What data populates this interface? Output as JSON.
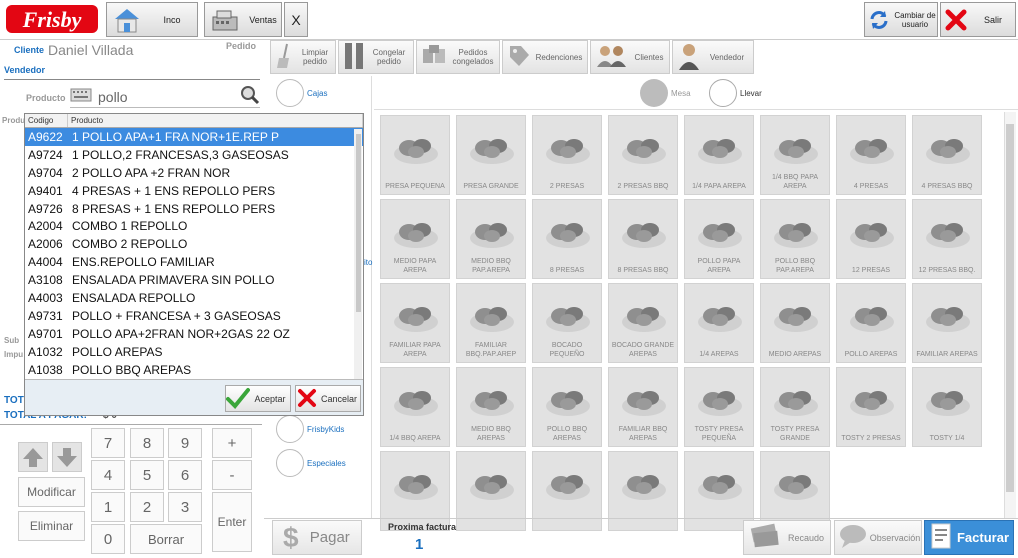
{
  "brand": {
    "logo_text": "Frisby",
    "accent": "#e30613",
    "blue": "#1a6fbf"
  },
  "toolbar": {
    "inicio_label": "Inco",
    "ventas_label": "Ventas",
    "close_label": "X",
    "cambiar_label_1": "Cambiar de",
    "cambiar_label_2": "usuario",
    "salir_label": "Salir"
  },
  "left": {
    "cliente_label": "Cliente",
    "cliente_value": "Daniel Villada",
    "pedido_label": "Pedido",
    "vendedor_label": "Vendedor",
    "producto_label": "Producto",
    "producto_value": "pollo",
    "produ_label": "Produ",
    "sub_label": "Sub",
    "impu_label": "Impu",
    "tot_label": "TOT",
    "total_pagar_label": "TOTAL A PAGAR:",
    "total_pagar_value": "$ 0"
  },
  "dropdown": {
    "col_codigo": "Codigo",
    "col_producto": "Producto",
    "rows": [
      {
        "code": "A9622",
        "name": "1 POLLO APA+1 FRA NOR+1E.REP P"
      },
      {
        "code": "A9724",
        "name": "1 POLLO,2 FRANCESAS,3 GASEOSAS"
      },
      {
        "code": "A9704",
        "name": "2 POLLO APA +2 FRAN NOR"
      },
      {
        "code": "A9401",
        "name": "4 PRESAS + 1 ENS REPOLLO PERS"
      },
      {
        "code": "A9726",
        "name": "8 PRESAS + 1 ENS REPOLLO PERS"
      },
      {
        "code": "A2004",
        "name": "COMBO 1 REPOLLO"
      },
      {
        "code": "A2006",
        "name": "COMBO 2 REPOLLO"
      },
      {
        "code": "A4004",
        "name": "ENS.REPOLLO FAMILIAR"
      },
      {
        "code": "A3108",
        "name": "ENSALADA PRIMAVERA SIN POLLO"
      },
      {
        "code": "A4003",
        "name": "ENSALADA REPOLLO"
      },
      {
        "code": "A9731",
        "name": "POLLO + FRANCESA + 3 GASEOSAS"
      },
      {
        "code": "A9701",
        "name": "POLLO APA+2FRAN NOR+2GAS 22 OZ"
      },
      {
        "code": "A1032",
        "name": "POLLO AREPAS"
      },
      {
        "code": "A1038",
        "name": "POLLO BBQ AREPAS"
      }
    ],
    "accept_label": "Aceptar",
    "cancel_label": "Cancelar"
  },
  "keypad": {
    "k7": "7",
    "k8": "8",
    "k9": "9",
    "plus": "+",
    "k4": "4",
    "k5": "5",
    "k6": "6",
    "minus": "-",
    "k1": "1",
    "k2": "2",
    "k3": "3",
    "k0": "0",
    "modificar": "Modificar",
    "eliminar": "Eliminar",
    "borrar": "Borrar",
    "enter": "Enter"
  },
  "tools": {
    "limpiar_1": "Limpiar",
    "limpiar_2": "pedido",
    "congelar_1": "Congelar",
    "congelar_2": "pedido",
    "pedidos_1": "Pedidos",
    "pedidos_2": "congelados",
    "redenciones": "Redenciones",
    "clientes": "Clientes",
    "vendedor": "Vendedor"
  },
  "categories": {
    "cajas": "Cajas",
    "frisbykids": "FrisbyKids",
    "especiales": "Especiales",
    "stray": "ito"
  },
  "service": {
    "mesa": "Mesa",
    "llevar": "Llevar"
  },
  "products": [
    "PRESA PEQUENA",
    "PRESA GRANDE",
    "2 PRESAS",
    "2 PRESAS BBQ",
    "1/4 PAPA AREPA",
    "1/4 BBQ PAPA AREPA",
    "4 PRESAS",
    "4 PRESAS BBQ",
    "MEDIO PAPA AREPA",
    "MEDIO BBQ PAP.AREPA",
    "8 PRESAS",
    "8 PRESAS BBQ",
    "POLLO PAPA AREPA",
    "POLLO BBQ PAP.AREPA",
    "12 PRESAS",
    "12 PRESAS BBQ.",
    "FAMILIAR PAPA AREPA",
    "FAMILIAR BBQ.PAP.AREP",
    "BOCADO PEQUEÑO",
    "BOCADO GRANDE AREPAS",
    "1/4 AREPAS",
    "MEDIO AREPAS",
    "POLLO AREPAS",
    "FAMILIAR AREPAS",
    "1/4 BBQ AREPA",
    "MEDIO BBQ AREPAS",
    "POLLO BBQ AREPAS",
    "FAMILIAR BBQ AREPAS",
    "TOSTY PRESA PEQUEÑA",
    "TOSTY PRESA GRANDE",
    "TOSTY 2 PRESAS",
    "TOSTY 1/4",
    "",
    "",
    "",
    "",
    "",
    ""
  ],
  "bottom": {
    "pagar": "Pagar",
    "proxima_label": "Proxima factura",
    "proxima_value": "1",
    "recaudo": "Recaudo",
    "observacion": "Observación",
    "facturar": "Facturar"
  }
}
